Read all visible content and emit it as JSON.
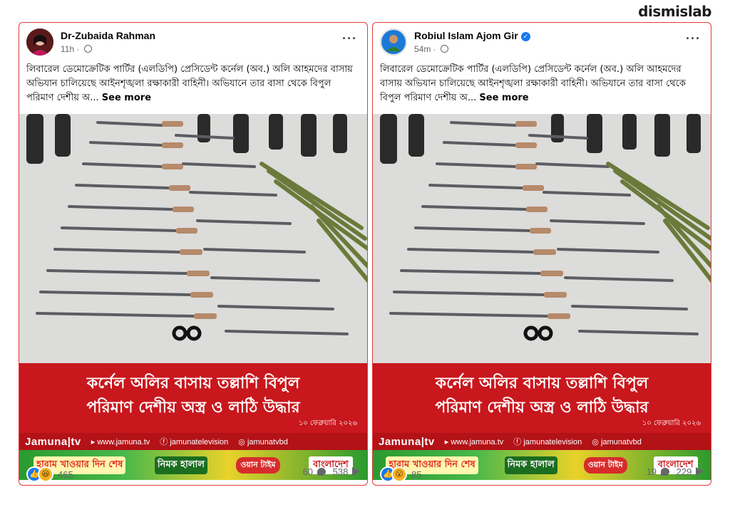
{
  "brand": "dismislab",
  "posts": [
    {
      "author": "Dr-Zubaida Rahman",
      "verified": false,
      "time": "11h",
      "caption": "লিবারেল ডেমোক্রেটিক পার্টির (এলডিপি) প্রেসিডেন্ট কর্নেল (অব.) অলি আহমদের বাসায় অভিযান চালিয়েছে আইনশৃঙ্খলা রক্ষাকারী বাহিনী। অভিযানে তার বাসা থেকে বিপুল পরিমাণ দেশীয় অ...",
      "see_more": "See more",
      "headline_1": "কর্নেল অলির বাসায় তল্লাশি বিপুল",
      "headline_2": "পরিমাণ দেশীয় অস্ত্র ও লাঠি উদ্ধার",
      "date": "১০ ফেব্রুয়ারি ২০২৬",
      "jamuna": "Jamuna|tv",
      "web": "www.jamuna.tv",
      "fb": "jamunatelevision",
      "ig": "jamunatvbd",
      "ad_1": "হারাম খাওয়ার দিন শেষ",
      "ad_2": "নিমক হালাল",
      "ad_3": "ওয়ান টাইম",
      "ad_4": "বাংলাদেশ",
      "reactions_count": "465",
      "comments": "60",
      "shares": "538"
    },
    {
      "author": "Robiul Islam Ajom Gir",
      "verified": true,
      "time": "54m",
      "caption": "লিবারেল ডেমোক্রেটিক পার্টির (এলডিপি) প্রেসিডেন্ট কর্নেল (অব.) অলি আহমদের বাসায় অভিযান চালিয়েছে আইনশৃঙ্খলা রক্ষাকারী বাহিনী। অভিযানে তার বাসা থেকে বিপুল পরিমাণ দেশীয় অ...",
      "see_more": "See more",
      "headline_1": "কর্নেল অলির বাসায় তল্লাশি বিপুল",
      "headline_2": "পরিমাণ দেশীয় অস্ত্র ও লাঠি উদ্ধার",
      "date": "১০ ফেব্রুয়ারি ২০২৬",
      "jamuna": "Jamuna|tv",
      "web": "www.jamuna.tv",
      "fb": "jamunatelevision",
      "ig": "jamunatvbd",
      "ad_1": "হারাম খাওয়ার দিন শেষ",
      "ad_2": "নিমক হালাল",
      "ad_3": "ওয়ান টাইম",
      "ad_4": "বাংলাদেশ",
      "reactions_count": "85",
      "comments": "19",
      "shares": "229"
    }
  ]
}
